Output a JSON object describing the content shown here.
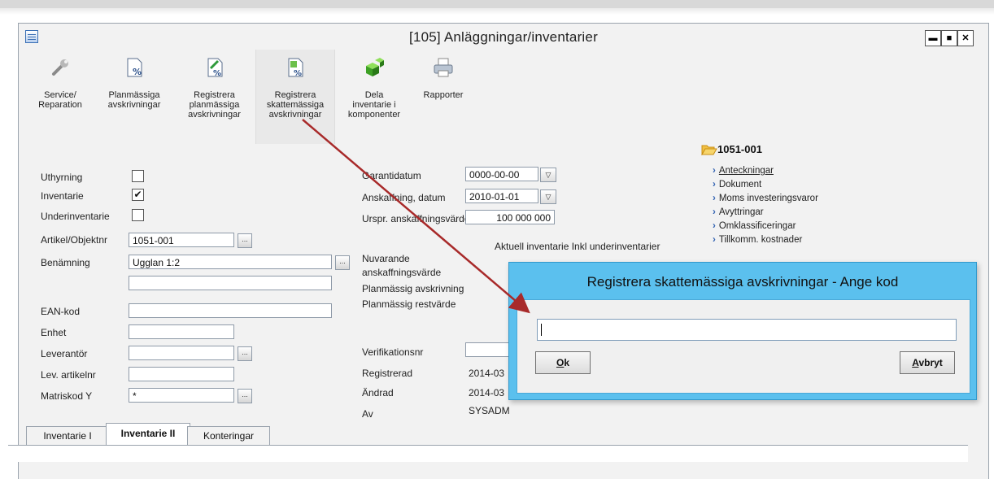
{
  "window": {
    "title": "[105]  Anläggningar/inventarier",
    "min": "▬",
    "max": "■",
    "close": "✕"
  },
  "toolbar": [
    {
      "label": "Service/\nReparation",
      "icon": "wrench-icon"
    },
    {
      "label": "Planmässiga\navskrivningar",
      "icon": "document-percent-icon"
    },
    {
      "label": "Registrera\nplanmässiga\navskrivningar",
      "icon": "document-percent-edit-icon"
    },
    {
      "label": "Registrera\nskattemässiga\navskrivningar",
      "icon": "document-percent-register-icon"
    },
    {
      "label": "Dela\ninventarie i\nkomponenter",
      "icon": "split-cubes-icon"
    },
    {
      "label": "Rapporter",
      "icon": "printer-icon"
    }
  ],
  "form_left": {
    "uthyrning": {
      "label": "Uthyrning",
      "checked": ""
    },
    "inventarie": {
      "label": "Inventarie",
      "checked": "✔"
    },
    "underinventarie": {
      "label": "Underinventarie",
      "checked": ""
    },
    "artikel": {
      "label": "Artikel/Objektnr",
      "value": "1051-001"
    },
    "benamning": {
      "label": "Benämning",
      "value": "Ugglan 1:2",
      "value2": ""
    },
    "ean": {
      "label": "EAN-kod",
      "value": ""
    },
    "enhet": {
      "label": "Enhet",
      "value": ""
    },
    "leverantor": {
      "label": "Leverantör",
      "value": ""
    },
    "levartikel": {
      "label": "Lev. artikelnr",
      "value": ""
    },
    "matriskod": {
      "label": "Matriskod Y",
      "value": "*"
    }
  },
  "form_mid": {
    "garantidatum": {
      "label": "Garantidatum",
      "value": "0000-00-00"
    },
    "anskaffning": {
      "label": "Anskaffning, datum",
      "value": "2010-01-01"
    },
    "urspr": {
      "label": "Urspr. anskaffningsvärde",
      "value": "100 000 000"
    },
    "nuvarande": {
      "label": "Nuvarande\nanskaffningsvärde"
    },
    "aktuell": "Aktuell inventarie Inkl underinventarier",
    "planavskr": {
      "label": "Planmässig avskrivning"
    },
    "planrest": {
      "label": "Planmässig restvärde"
    },
    "verifikation": {
      "label": "Verifikationsnr",
      "value": ""
    },
    "registrerad": {
      "label": "Registrerad",
      "value": "2014-03"
    },
    "andrad": {
      "label": "Ändrad",
      "value": "2014-03"
    },
    "av": {
      "label": "Av",
      "value": "SYSADM"
    }
  },
  "tree": {
    "root": "1051-001",
    "items": [
      "Anteckningar",
      "Dokument",
      "Moms investeringsvaror",
      "Avyttringar",
      "Omklassificeringar",
      "Tillkomm. kostnader"
    ]
  },
  "tabs": [
    "Inventarie I",
    "Inventarie II",
    "Konteringar"
  ],
  "dialog": {
    "title": "Registrera skattemässiga avskrivningar - Ange kod",
    "input_value": "",
    "ok_underline": "O",
    "ok_rest": "k",
    "cancel_underline": "A",
    "cancel_rest": "vbryt"
  },
  "colors": {
    "dialog_frame": "#5bc0ee",
    "arrow": "#a82a2a"
  }
}
